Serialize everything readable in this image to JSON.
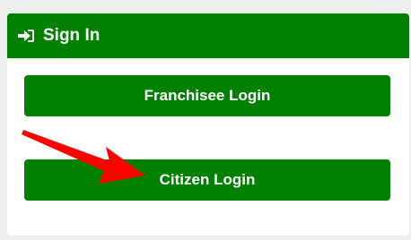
{
  "header": {
    "title": "Sign In",
    "icon": "sign-in-icon"
  },
  "buttons": {
    "franchisee_login": "Franchisee Login",
    "citizen_login": "Citizen Login"
  },
  "annotation": {
    "icon": "red-arrow-annotation",
    "color": "#ff0000"
  },
  "colors": {
    "brand_green": "#008000",
    "background": "#eeeeee"
  }
}
